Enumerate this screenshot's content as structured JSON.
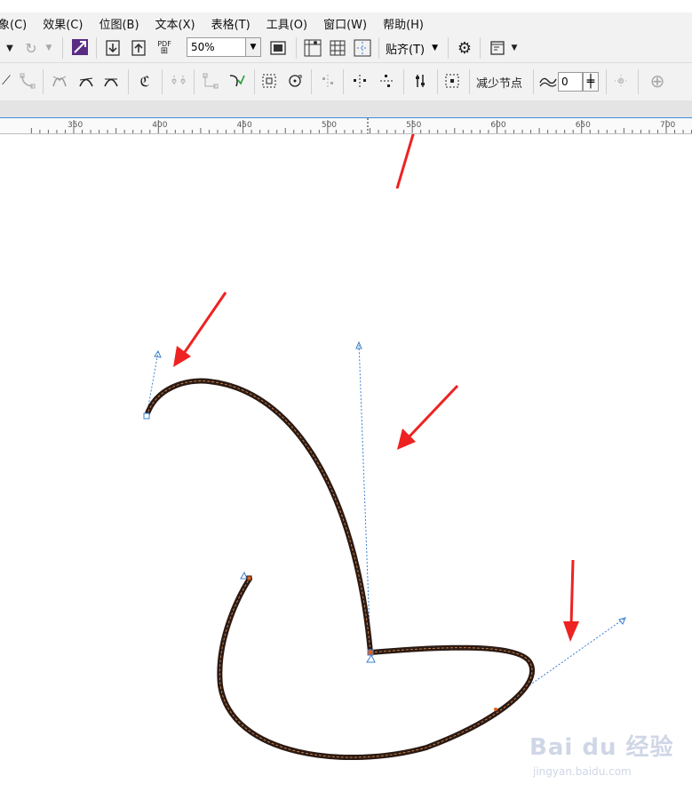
{
  "menu": [
    "象(C)",
    "效果(C)",
    "位图(B)",
    "文本(X)",
    "表格(T)",
    "工具(O)",
    "窗口(W)",
    "帮助(H)"
  ],
  "toolbar": {
    "zoom_value": "50%",
    "snap_label": "贴齐(T)",
    "pdf_label": "PDF",
    "reduce_nodes_label": "减少节点",
    "smoothness_value": "0"
  },
  "ruler": {
    "labels": [
      "350",
      "400",
      "450",
      "500",
      "550",
      "600",
      "650",
      "700"
    ],
    "label_values": [
      350,
      400,
      450,
      500,
      550,
      600,
      650,
      700
    ]
  },
  "watermark": {
    "logo": "Bai du 经验",
    "url": "jingyan.baidu.com"
  },
  "colors": {
    "curve": "#2b1a14",
    "curve_highlight": "#d98a4a",
    "control_handle": "#3a7fd0",
    "node_fill": "#e0601a",
    "annotation_arrow": "#ee2222",
    "selection_bar": "#3c8edc"
  },
  "icons": [
    "arrow-tool-icon",
    "undo-redo-icon",
    "align-icon",
    "import-icon",
    "export-icon",
    "pdf-icon",
    "fullscreen-icon",
    "ruler-icon",
    "grid-icon",
    "guides-icon",
    "gear-icon",
    "window-icon",
    "node-tool-icons",
    "smoothness-icon",
    "add-icon"
  ]
}
